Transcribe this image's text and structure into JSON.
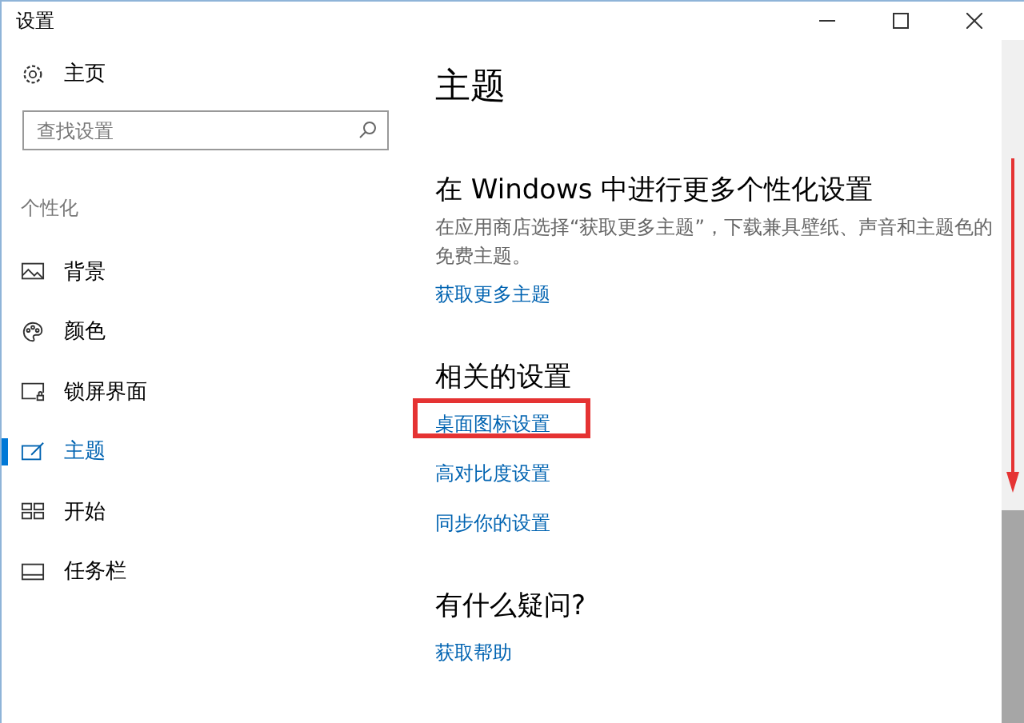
{
  "window": {
    "title": "设置"
  },
  "sidebar": {
    "home": "主页",
    "search": {
      "placeholder": "查找设置"
    },
    "section": "个性化",
    "items": [
      {
        "label": "背景",
        "kind": "picture",
        "selected": false
      },
      {
        "label": "颜色",
        "kind": "palette",
        "selected": false
      },
      {
        "label": "锁屏界面",
        "kind": "lockscreen",
        "selected": false
      },
      {
        "label": "主题",
        "kind": "theme",
        "selected": true
      },
      {
        "label": "开始",
        "kind": "start",
        "selected": false
      },
      {
        "label": "任务栏",
        "kind": "taskbar",
        "selected": false
      }
    ]
  },
  "main": {
    "title": "主题",
    "sections": [
      {
        "heading": "在 Windows 中进行更多个性化设置",
        "description": "在应用商店选择“获取更多主题”，下载兼具壁纸、声音和主题色的免费主题。",
        "links": [
          {
            "label": "获取更多主题",
            "highlighted": false
          }
        ]
      },
      {
        "heading": "相关的设置",
        "links": [
          {
            "label": "桌面图标设置",
            "highlighted": true
          },
          {
            "label": "高对比度设置",
            "highlighted": false
          },
          {
            "label": "同步你的设置",
            "highlighted": false
          }
        ]
      },
      {
        "heading": "有什么疑问?",
        "links": [
          {
            "label": "获取帮助",
            "highlighted": false
          }
        ]
      }
    ]
  },
  "scroll_arrow": true
}
